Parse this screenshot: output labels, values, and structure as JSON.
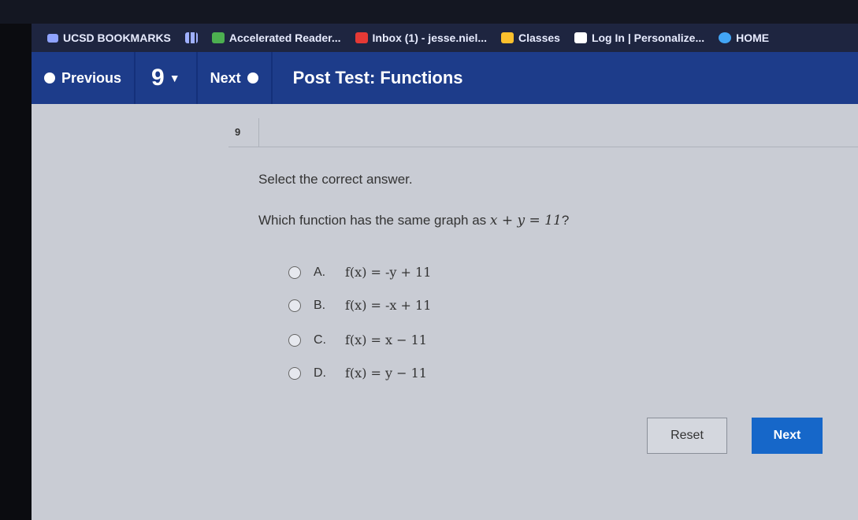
{
  "bookmarks": [
    {
      "label": "UCSD BOOKMARKS",
      "icon": "folder-icon",
      "color": "#8fa3ff"
    },
    {
      "label": "",
      "icon": "apps-grid-icon",
      "color": "#9fb0ff"
    },
    {
      "label": "Accelerated Reader...",
      "icon": "ar-icon",
      "color": "#4caf50"
    },
    {
      "label": "Inbox (1) - jesse.niel...",
      "icon": "mail-icon",
      "color": "#e53935"
    },
    {
      "label": "Classes",
      "icon": "classes-icon",
      "color": "#fbc02d"
    },
    {
      "label": "Log In | Personalize...",
      "icon": "s-logo-icon",
      "color": "#ffffff"
    },
    {
      "label": "HOME",
      "icon": "home-icon",
      "color": "#42a5f5"
    }
  ],
  "nav": {
    "previous_label": "Previous",
    "question_number": "9",
    "next_label": "Next",
    "title": "Post Test: Functions"
  },
  "question": {
    "tab_number": "9",
    "instruction": "Select the correct answer.",
    "text_prefix": "Which function has the same graph as ",
    "equation": "x + y = 11",
    "text_suffix": "?",
    "options": [
      {
        "letter": "A.",
        "expr": "f(x) = -y + 11"
      },
      {
        "letter": "B.",
        "expr": "f(x) = -x + 11"
      },
      {
        "letter": "C.",
        "expr": "f(x) = x − 11"
      },
      {
        "letter": "D.",
        "expr": "f(x) = y − 11"
      }
    ]
  },
  "buttons": {
    "reset": "Reset",
    "next": "Next"
  },
  "colors": {
    "nav_bg": "#1d3c8a",
    "next_button": "#1667c9",
    "content_bg": "#c9ccd4"
  }
}
